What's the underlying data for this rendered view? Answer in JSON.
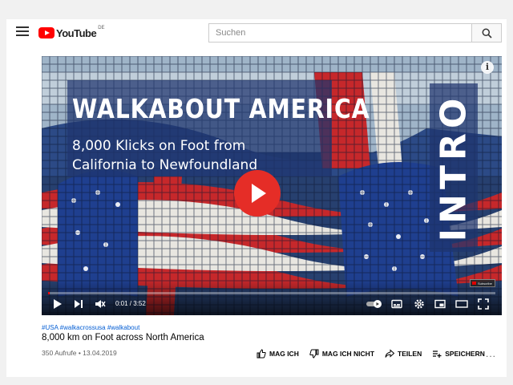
{
  "header": {
    "logo_text": "YouTube",
    "country_code": "DE",
    "search_placeholder": "Suchen"
  },
  "player": {
    "title_main": "WALKABOUT AMERICA",
    "subtitle_line1": "8,000  Klicks on Foot  from",
    "subtitle_line2": "California to Newfoundland",
    "intro_label": "INTRO",
    "info_label": "i",
    "subscribe_badge": "Subscribe",
    "current_time": "0:01 / 3:52",
    "progress": 0.004
  },
  "video": {
    "hashtags": "#USA #walkacrossusa #walkabout",
    "title": "8,000 km on Foot across North America",
    "views_date": "350 Aufrufe • 13.04.2019"
  },
  "actions": {
    "like": "MAG ICH",
    "dislike": "MAG ICH NICHT",
    "share": "TEILEN",
    "save": "SPEICHERN",
    "more": "..."
  },
  "colors": {
    "brand_red": "#ff0000",
    "play_button": "#e52d27",
    "link_blue": "#065fd4"
  }
}
